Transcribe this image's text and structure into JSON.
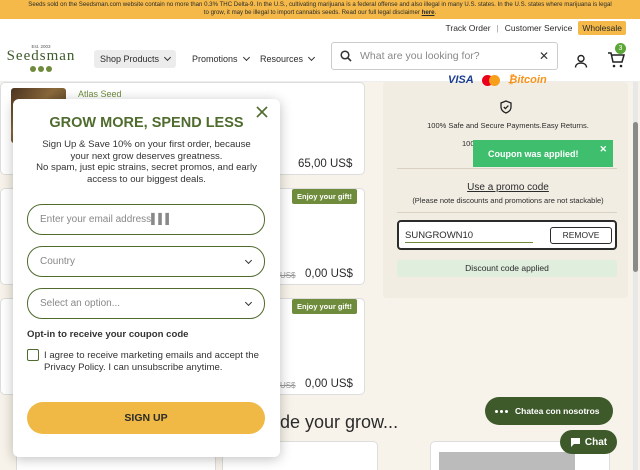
{
  "banner": {
    "line1": "Seeds sold on the Seedsman.com website contain no more than 0.3% THC Delta-9. In the U.S., cultivating marijuana is a federal offense and also illegal in many U.S. states. In the U.S. states where marijuana is legal",
    "line2": "to grow, it may be illegal to import cannabis seeds. Read our full legal disclaimer",
    "link": "here",
    "color": "#f4b949"
  },
  "utility": {
    "track_order": "Track Order",
    "separator": "|",
    "customer_service": "Customer Service",
    "wholesale": "Wholesale"
  },
  "header": {
    "logo_est": "Est. 2003",
    "logo_word": "Seedsman",
    "nav": [
      "Shop Products",
      "Promotions",
      "Resources"
    ],
    "search_placeholder": "What are you looking for?",
    "cart_count": "3",
    "brand_color": "#3e5a2b"
  },
  "products": {
    "atlas": "Atlas Seed",
    "price1": "65,00 US$",
    "gift_label": "Enjoy your gift!",
    "struck_price": "US$",
    "free_price": "0,00 US$",
    "section_heading": "de your grow..."
  },
  "checkout": {
    "payment_icons": [
      "VISA",
      "mastercard",
      "bitcoin"
    ],
    "safe_text": "100% Safe and Secure Payments.Easy Returns.",
    "partial": "100",
    "toast": "Coupon was applied!",
    "promo_title": "Use a promo code",
    "promo_note": "(Please note discounts and promotions are not stackable)",
    "code_value": "SUNGROWN10",
    "remove": "REMOVE",
    "applied": "Discount code applied",
    "toast_color": "#3fbf6e"
  },
  "chat": {
    "chatea": "Chatea con nosotros",
    "chat": "Chat"
  },
  "modal": {
    "title": "GROW MORE, SPEND LESS",
    "subtitle_1": "Sign Up & Save 10% on your first order, because",
    "subtitle_2": "your next grow deserves greatness.",
    "subtitle_3": "No spam, just epic strains, secret promos, and early",
    "subtitle_4": "access to our biggest deals.",
    "email_placeholder": "Enter your email address▌▌▌",
    "country_placeholder": "Country",
    "option_placeholder": "Select an option...",
    "optin_label": "Opt-in to receive your coupon code",
    "agree_text": "I agree to receive marketing emails and accept the Privacy Policy. I can unsubscribe anytime.",
    "signup": "SIGN UP",
    "accent": "#4f6b2d",
    "button_color": "#f0b945"
  }
}
